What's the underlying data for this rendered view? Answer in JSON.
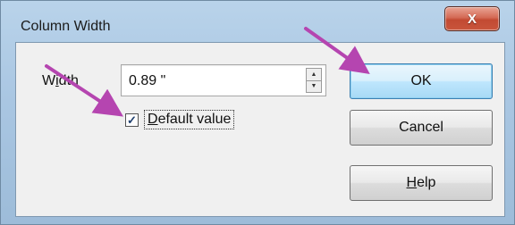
{
  "dialog": {
    "title": "Column Width",
    "close_label": "X"
  },
  "width_field": {
    "label_prefix": "W",
    "label_underlined": "i",
    "label_suffix": "dth",
    "value": "0.89 \""
  },
  "default_value": {
    "checked": true,
    "checkmark": "✓",
    "label_underlined": "D",
    "label_suffix": "efault value"
  },
  "buttons": {
    "ok": "OK",
    "cancel": "Cancel",
    "help_underlined": "H",
    "help_suffix": "elp"
  },
  "icons": {
    "spin_up": "▲",
    "spin_down": "▼"
  },
  "colors": {
    "annotation_arrow": "#b545b0"
  }
}
